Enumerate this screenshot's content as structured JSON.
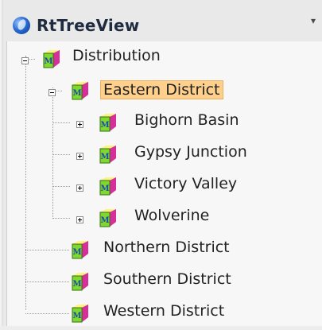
{
  "app": {
    "title": "RtTreeView"
  },
  "tree": {
    "root": {
      "label": "Distribution"
    },
    "eastern": {
      "label": "Eastern District"
    },
    "eastern_children": [
      {
        "label": "Bighorn Basin"
      },
      {
        "label": "Gypsy Junction"
      },
      {
        "label": "Victory Valley"
      },
      {
        "label": "Wolverine"
      }
    ],
    "other": [
      {
        "label": "Northern District"
      },
      {
        "label": "Southern District"
      },
      {
        "label": "Western District"
      }
    ]
  },
  "icons": {
    "node": "m-box-icon",
    "toggle": "expand-collapse-icon",
    "logo": "app-logo-icon"
  },
  "colors": {
    "selected_bg": "#ffd08c",
    "text": "#222222"
  }
}
